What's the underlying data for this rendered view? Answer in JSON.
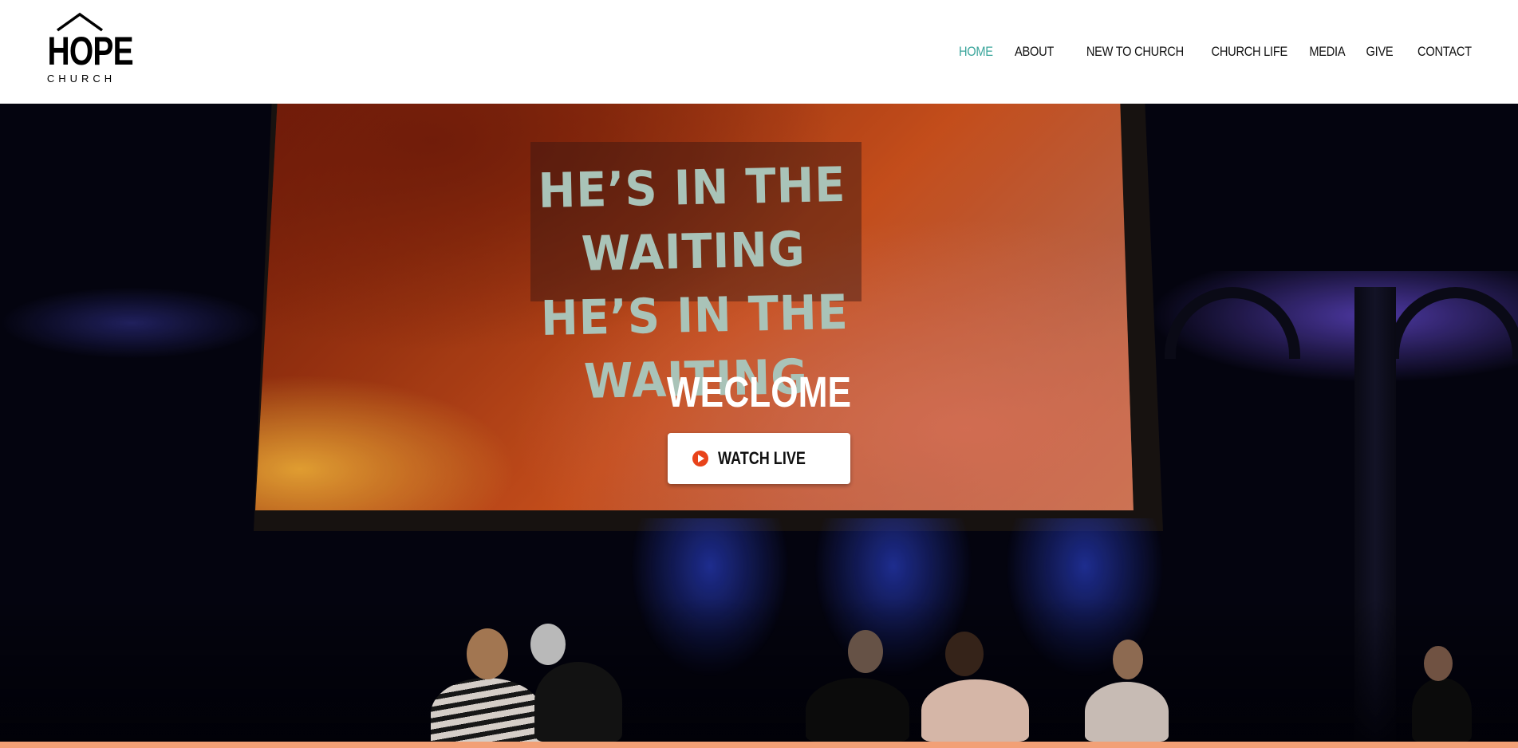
{
  "header": {
    "logo": {
      "main": "HOPE",
      "sub": "CHURCH",
      "icon": "house-roof-icon"
    },
    "nav": [
      {
        "label": "HOME",
        "active": true
      },
      {
        "label": "ABOUT",
        "active": false
      },
      {
        "label": "NEW TO CHURCH",
        "active": false
      },
      {
        "label": "CHURCH LIFE",
        "active": false
      },
      {
        "label": "MEDIA",
        "active": false
      },
      {
        "label": "GIVE",
        "active": false
      },
      {
        "label": "CONTACT",
        "active": false
      }
    ],
    "active_color": "#3aa59b"
  },
  "hero": {
    "screen_lyrics": [
      "HE’S IN THE WAITING",
      "HE’S IN THE WAITING"
    ],
    "title": "WECLOME",
    "cta": {
      "label": "WATCH LIVE",
      "icon": "play-circle-icon",
      "icon_color": "#e8431a"
    }
  },
  "accent_bar_color": "#f2a076"
}
